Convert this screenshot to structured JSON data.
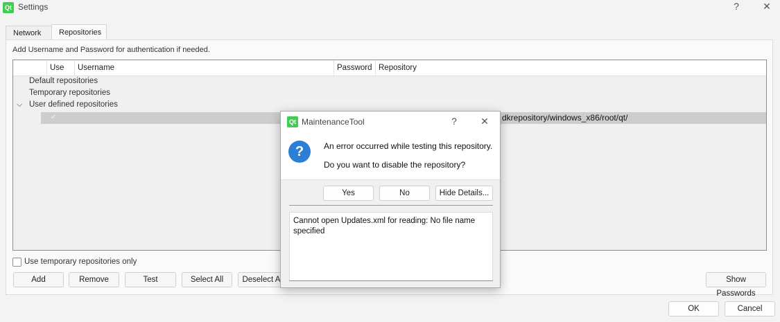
{
  "window": {
    "title": "Settings",
    "logo_text": "Qt",
    "help_symbol": "?",
    "close_symbol": "✕"
  },
  "tabs": [
    {
      "label": "Network",
      "active": false
    },
    {
      "label": "Repositories",
      "active": true
    }
  ],
  "hint": "Add Username and Password for authentication if needed.",
  "tree": {
    "columns": [
      "Use",
      "Username",
      "Password",
      "Repository"
    ],
    "items": [
      {
        "label": "Default repositories"
      },
      {
        "label": "Temporary repositories"
      },
      {
        "label": "User defined repositories",
        "expanded": true
      }
    ],
    "selected_row": {
      "checked": true,
      "repository_visible": "dkrepository/windows_x86/root/qt/"
    }
  },
  "temp_only": {
    "label": "Use temporary repositories only",
    "checked": false
  },
  "buttons": {
    "add": "Add",
    "remove": "Remove",
    "test": "Test",
    "select_all": "Select All",
    "deselect_all": "Deselect All",
    "show_passwords": "Show Passwords",
    "ok": "OK",
    "cancel": "Cancel"
  },
  "dialog": {
    "title": "MaintenanceTool",
    "logo_text": "Qt",
    "help_symbol": "?",
    "close_symbol": "✕",
    "icon_symbol": "?",
    "message": "An error occurred while testing this repository.",
    "question": "Do you want to disable the repository?",
    "yes": "Yes",
    "no": "No",
    "hide_details": "Hide Details...",
    "details": "Cannot open Updates.xml for reading: No file name specified"
  },
  "colors": {
    "qt_green": "#41cd52",
    "question_blue": "#2c7ed6",
    "selection_gray": "#cdcdcd"
  }
}
